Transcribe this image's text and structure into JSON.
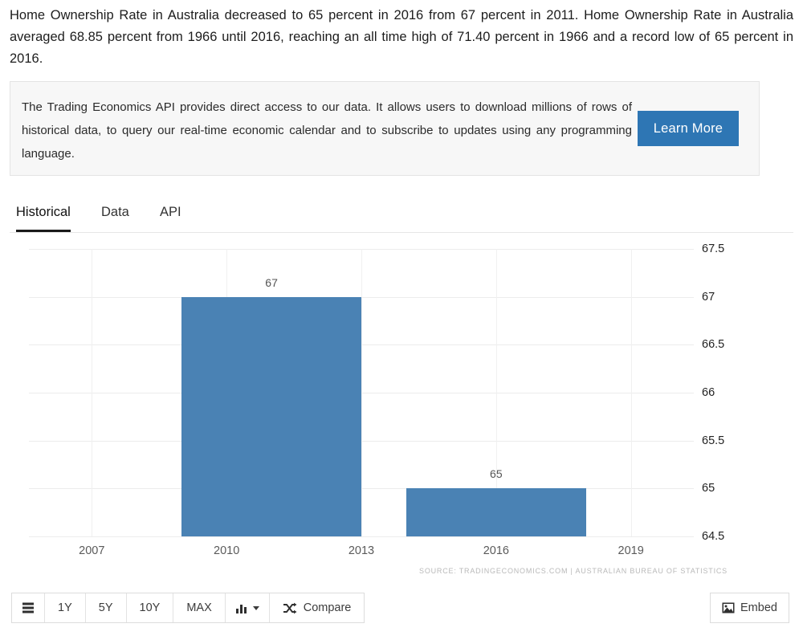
{
  "intro": {
    "paragraph": "Home Ownership Rate in Australia decreased to 65 percent in 2016 from 67 percent in 2011. Home Ownership Rate in Australia averaged 68.85 percent from 1966 until 2016, reaching an all time high of 71.40 percent in 1966 and a record low of 65 percent in 2016."
  },
  "api_promo": {
    "text": "The Trading Economics API provides direct access to our data. It allows users to download millions of rows of historical data, to query our real-time economic calendar and to subscribe to updates using any programming language.",
    "button_label": "Learn More",
    "button_color": "#2e76b4"
  },
  "tabs": [
    {
      "label": "Historical",
      "active": true
    },
    {
      "label": "Data",
      "active": false
    },
    {
      "label": "API",
      "active": false
    }
  ],
  "chart_data": {
    "type": "bar",
    "title": "",
    "xlabel": "",
    "ylabel": "",
    "categories": [
      "2011",
      "2016"
    ],
    "values": [
      67,
      65
    ],
    "value_labels": [
      "67",
      "65"
    ],
    "ylim": [
      64.5,
      67.5
    ],
    "y_ticks": [
      "67.5",
      "67",
      "66.5",
      "66",
      "65.5",
      "65",
      "64.5"
    ],
    "y_tick_values": [
      67.5,
      67,
      66.5,
      66,
      65.5,
      65,
      64.5
    ],
    "x_ticks": [
      "2007",
      "2010",
      "2013",
      "2016",
      "2019"
    ],
    "x_tick_values": [
      2007,
      2010,
      2013,
      2016,
      2019
    ],
    "xlim": [
      2005.6,
      2020.4
    ],
    "grid": true,
    "legend": "none",
    "series_color": "#4a82b4",
    "source": "SOURCE: TRADINGECONOMICS.COM | AUSTRALIAN BUREAU OF STATISTICS"
  },
  "toolbar": {
    "menu_icon": "list-icon",
    "ranges": [
      "1Y",
      "5Y",
      "10Y",
      "MAX"
    ],
    "chart_type_icon": "bar-chart-icon",
    "compare_icon": "shuffle-icon",
    "compare_label": "Compare",
    "embed_icon": "image-icon",
    "embed_label": "Embed"
  }
}
